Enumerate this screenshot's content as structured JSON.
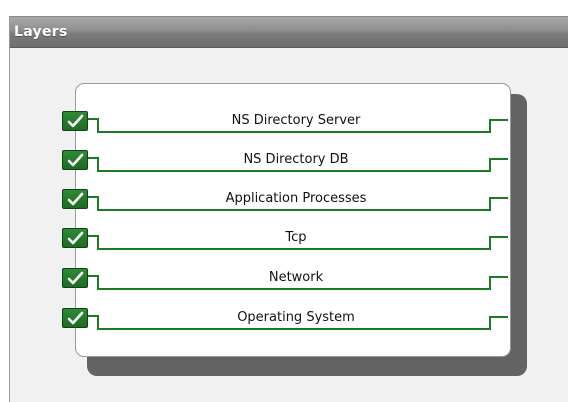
{
  "panel": {
    "title": "Layers"
  },
  "layers": [
    {
      "label": "NS Directory Server",
      "checked": true
    },
    {
      "label": "NS Directory DB",
      "checked": true
    },
    {
      "label": "Application Processes",
      "checked": true
    },
    {
      "label": "Tcp",
      "checked": true
    },
    {
      "label": "Network",
      "checked": true
    },
    {
      "label": "Operating System",
      "checked": true
    }
  ],
  "colors": {
    "check_green": "#1d6b23",
    "line_green": "#1d7a25",
    "header_gray": "#8e8e8e"
  }
}
